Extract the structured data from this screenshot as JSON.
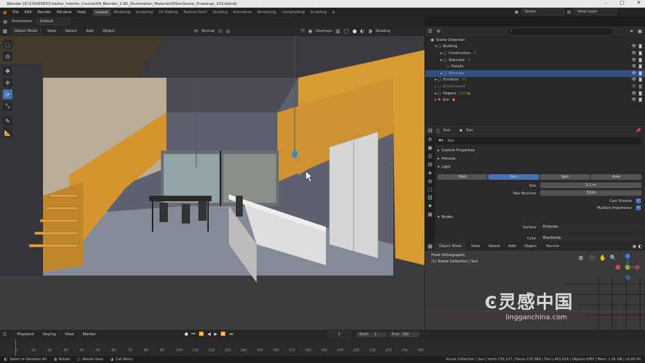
{
  "window": {
    "title": "Blender [E:\\COURSES\\Chezfur_Interior_Course\\04_Blender_2.80_Illumination_Materials\\Files\\Scene_Drawings_103.blend]"
  },
  "menu": [
    "File",
    "Edit",
    "Render",
    "Window",
    "Help"
  ],
  "workspaces": [
    {
      "label": "Layout",
      "active": true
    },
    {
      "label": "Modeling"
    },
    {
      "label": "Sculpting"
    },
    {
      "label": "UV Editing"
    },
    {
      "label": "Texture Paint"
    },
    {
      "label": "Shading"
    },
    {
      "label": "Animation"
    },
    {
      "label": "Rendering"
    },
    {
      "label": "Compositing"
    },
    {
      "label": "Scripting"
    }
  ],
  "scene": {
    "label": "Scene",
    "view_layer": "View Layer"
  },
  "toolheader": {
    "orientation": "Orientation",
    "orientation_value": "Default"
  },
  "viewport_header": {
    "mode": "Object Mode",
    "menus": [
      "View",
      "Select",
      "Add",
      "Object"
    ],
    "transform": "Normal",
    "overlays": "Overlays",
    "shading": "Shading"
  },
  "outliner": {
    "rows": [
      {
        "label": "Scene Collection",
        "indent": 0
      },
      {
        "label": "Building",
        "indent": 1
      },
      {
        "label": "Construction",
        "indent": 2
      },
      {
        "label": "Staircase",
        "indent": 2
      },
      {
        "label": "Details",
        "indent": 2
      },
      {
        "label": "Windows",
        "indent": 2,
        "selected": true
      },
      {
        "label": "Furniture",
        "indent": 1
      },
      {
        "label": "Environment",
        "indent": 1
      },
      {
        "label": "Helpers",
        "indent": 1
      },
      {
        "label": "Sun",
        "indent": 1
      }
    ]
  },
  "properties": {
    "object": "Sun",
    "data": "Sun",
    "datablock": "Sun",
    "sections": {
      "custom": "Custom Properties",
      "preview": "Preview",
      "light": "Light",
      "nodes": "Nodes"
    },
    "light_types": [
      "Point",
      "Sun",
      "Spot",
      "Area"
    ],
    "active_light_type": "Sun",
    "size_label": "Size",
    "size_value": "0.1 m",
    "bounces_label": "Max Bounces",
    "bounces_value": "1024",
    "cast_shadow": "Cast Shadow",
    "multiple_importance": "Multiple Importance",
    "surface_label": "Surface",
    "surface_value": "Emission",
    "color_label": "Color",
    "color_value": "Blackbody"
  },
  "small_viewport": {
    "mode": "Object Mode",
    "menus": [
      "View",
      "Select",
      "Add",
      "Object"
    ],
    "transform": "Normal",
    "view_name": "Front Orthographic",
    "collection": "(1) Scene Collection | Sun"
  },
  "watermark": {
    "cn": "灵感中国",
    "url": "lingganchina.com"
  },
  "timeline": {
    "menus": [
      "Playback",
      "Keying",
      "View",
      "Marker"
    ],
    "current_frame": "1",
    "start_label": "Start:",
    "start": "1",
    "end_label": "End:",
    "end": "250",
    "ticks": [
      "0",
      "10",
      "20",
      "30",
      "40",
      "50",
      "60",
      "70",
      "80",
      "90",
      "100",
      "110",
      "120",
      "130",
      "140",
      "150",
      "160",
      "170",
      "180",
      "190",
      "200",
      "210",
      "220",
      "230",
      "240",
      "250"
    ]
  },
  "status": {
    "left": [
      "Select or Deselect All",
      "Rotate",
      "Rotate View",
      "Call Menu"
    ],
    "right": "Scene Collection | Sun | Verts:733,127 | Faces:725,066 | Tris:1,461,618 | Objects:0/83 | Mem: 1.91 GB | v2.80.45"
  },
  "colors": {
    "accent": "#4772b3",
    "wood": "#d4952f",
    "selected_row": "#334d80"
  }
}
